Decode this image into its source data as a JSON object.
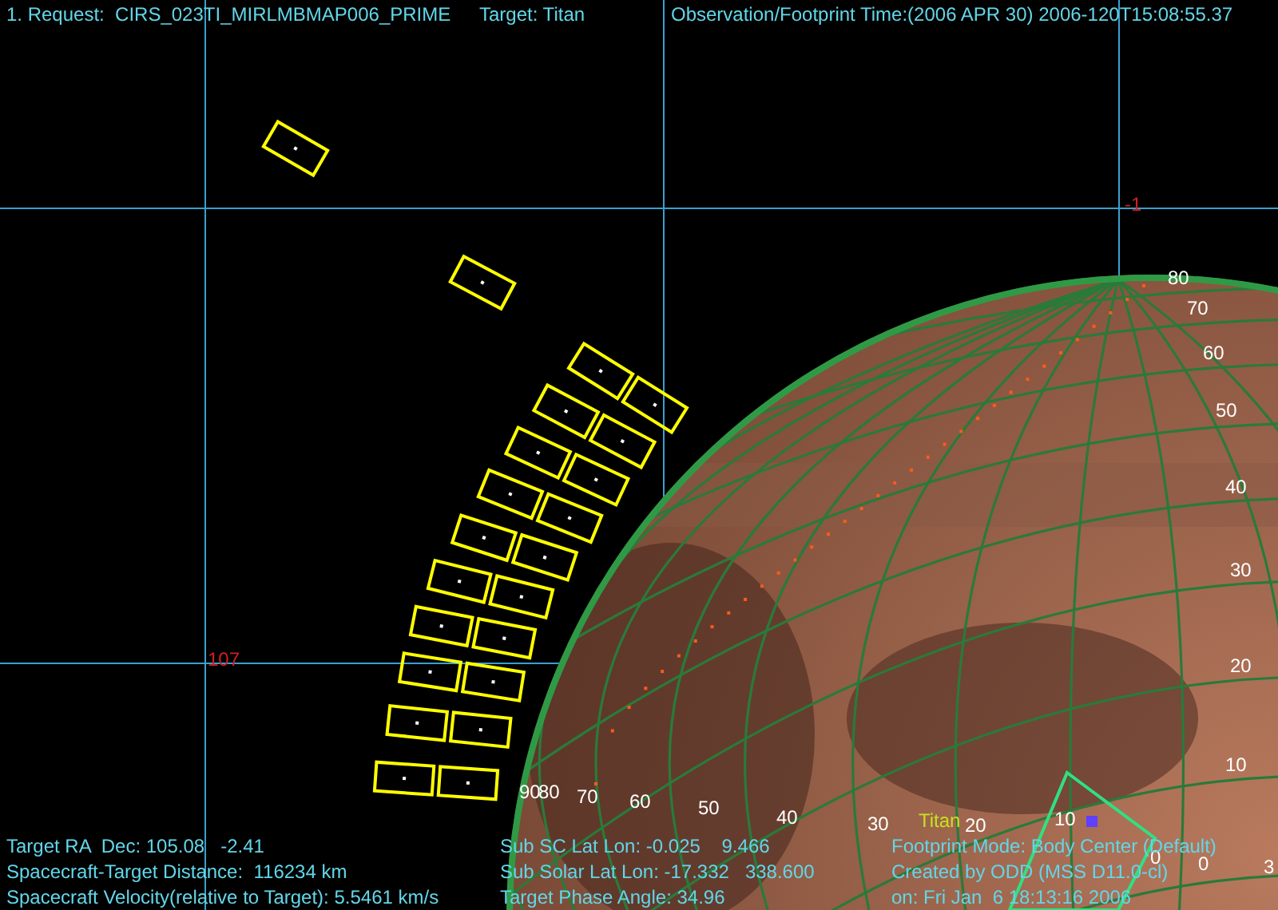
{
  "header": {
    "request": "1. Request:  CIRS_023TI_MIRLMBMAP006_PRIME",
    "target": "Target: Titan",
    "time": "Observation/Footprint Time:(2006 APR 30) 2006-120T15:08:55.37"
  },
  "grid_labels": [
    "-1",
    "107"
  ],
  "latitude_labels": [
    "80",
    "70",
    "60",
    "50",
    "40",
    "30",
    "20",
    "10"
  ],
  "longitude_labels": [
    "90",
    "80",
    "70",
    "60",
    "50",
    "40",
    "30",
    "20",
    "10",
    "0",
    "0",
    "3"
  ],
  "body_label": "Titan",
  "info_left": [
    "Target RA  Dec: 105.08   -2.41",
    "Spacecraft-Target Distance:  116234 km",
    "Spacecraft Velocity(relative to Target): 5.5461 km/s"
  ],
  "info_middle": [
    "Sub SC Lat Lon: -0.025    9.466",
    "Sub Solar Lat Lon: -17.332   338.600",
    "Target Phase Angle: 34.96"
  ],
  "info_right": [
    "Footprint Mode: Body Center (Default)",
    "Created by ODD (MSS D11.0-cl)",
    "on: Fri Jan  6 18:13:16 2006"
  ]
}
